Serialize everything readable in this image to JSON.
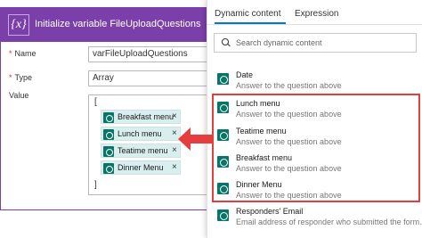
{
  "action": {
    "icon": "{x}",
    "title": "Initialize variable FileUploadQuestions",
    "header_color": "#7b3fa9",
    "name_label": "Name",
    "name_value": "varFileUploadQuestions",
    "type_label": "Type",
    "type_value": "Array",
    "value_label": "Value",
    "open_bracket": "[",
    "close_bracket": "]",
    "tokens": [
      {
        "label": "Breakfast menu",
        "close": "×"
      },
      {
        "label": "Lunch menu",
        "close": "×"
      },
      {
        "label": "Teatime menu",
        "close": "×"
      },
      {
        "label": "Dinner Menu",
        "close": "×"
      }
    ]
  },
  "panel": {
    "tabs": [
      {
        "label": "Dynamic content",
        "active": true
      },
      {
        "label": "Expression",
        "active": false
      }
    ],
    "search_placeholder": "Search dynamic content",
    "items": [
      {
        "title": "Date",
        "desc": "Answer to the question above"
      },
      {
        "title": "Lunch menu",
        "desc": "Answer to the question above"
      },
      {
        "title": "Teatime menu",
        "desc": "Answer to the question above"
      },
      {
        "title": "Breakfast menu",
        "desc": "Answer to the question above"
      },
      {
        "title": "Dinner Menu",
        "desc": "Answer to the question above"
      },
      {
        "title": "Responders' Email",
        "desc": "Email address of responder who submitted the form."
      }
    ]
  },
  "colors": {
    "accent": "#7b3fa9",
    "forms_icon": "#077568",
    "token_bg": "#d9eeee",
    "highlight": "#e53e3e",
    "tab_underline": "#0078d4"
  }
}
